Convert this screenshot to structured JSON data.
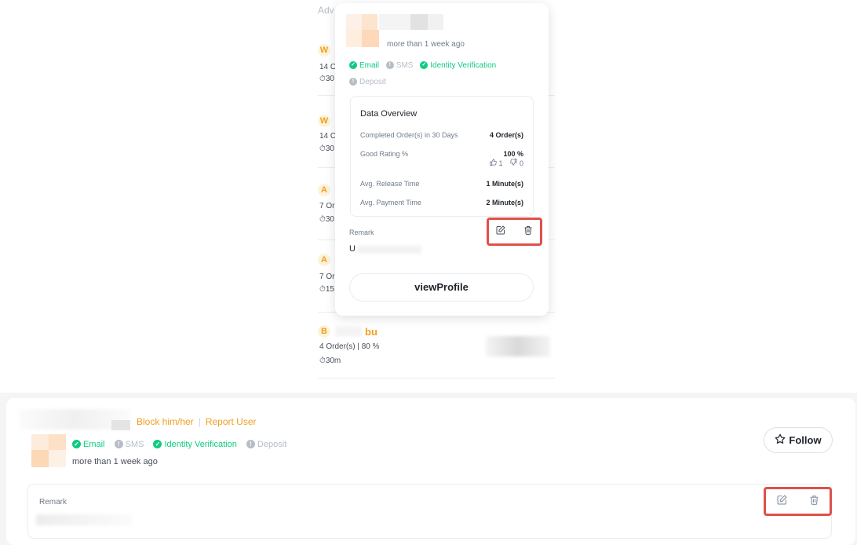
{
  "advertiser_list": {
    "header": "Adv",
    "items": [
      {
        "initial": "W",
        "stats": "14 O",
        "time": "30"
      },
      {
        "initial": "W",
        "stats": "14 C",
        "time": "30"
      },
      {
        "initial": "A",
        "stats": "7 Or",
        "time": "30"
      },
      {
        "initial": "A",
        "stats": "7 Or",
        "time": "15"
      },
      {
        "initial": "B",
        "name_tail": "bu",
        "stats": "4 Order(s)  |  80 %",
        "time": "30m"
      }
    ]
  },
  "popup": {
    "last_seen": "more than 1 week ago",
    "verifications": {
      "email": "Email",
      "sms": "SMS",
      "identity": "Identity Verification",
      "deposit": "Deposit"
    },
    "overview": {
      "title": "Data Overview",
      "completed_label": "Completed Order(s) in 30 Days",
      "completed_value": "4 Order(s)",
      "rating_label": "Good Rating %",
      "rating_value": "100 %",
      "thumbs_up": "1",
      "thumbs_down": "0",
      "release_label": "Avg. Release Time",
      "release_value": "1 Minute(s)",
      "payment_label": "Avg. Payment Time",
      "payment_value": "2 Minute(s)"
    },
    "remark_label": "Remark",
    "remark_value": "U",
    "view_profile": "viewProfile"
  },
  "profile_card": {
    "block": "Block him/her",
    "report": "Report User",
    "verifications": {
      "email": "Email",
      "sms": "SMS",
      "identity": "Identity Verification",
      "deposit": "Deposit"
    },
    "last_seen": "more than 1 week ago",
    "follow": "Follow",
    "remark_label": "Remark"
  },
  "colors": {
    "accent": "#f0a020",
    "verified": "#0ecb81",
    "unverified": "#b7bdc6",
    "highlight": "#e0504a"
  },
  "icons": [
    "edit-icon",
    "trash-icon",
    "star-icon",
    "check-icon",
    "thumb-up-icon",
    "thumb-down-icon",
    "clock-icon"
  ]
}
